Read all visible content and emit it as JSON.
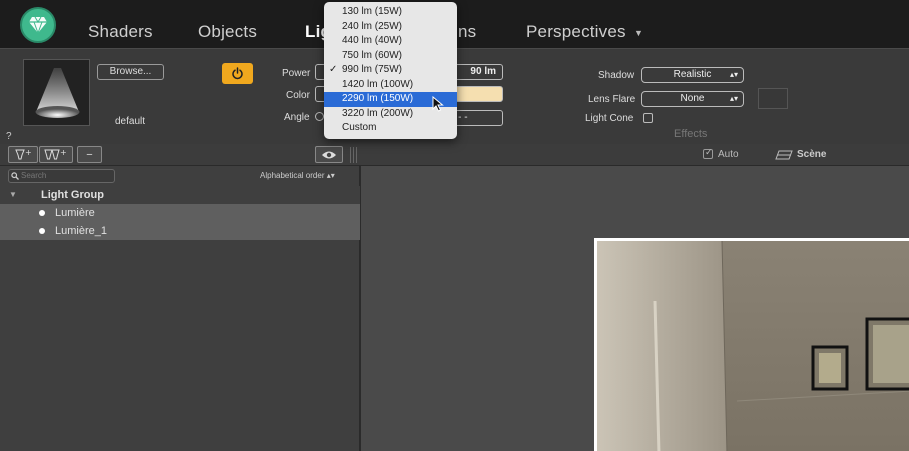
{
  "tabs": [
    {
      "label": "Shaders",
      "active": false
    },
    {
      "label": "Objects",
      "active": false
    },
    {
      "label": "Lig",
      "active": true
    },
    {
      "label": "ns",
      "active": false
    },
    {
      "label": "Perspectives",
      "active": false
    }
  ],
  "colors": {
    "accent_green": "#3fb98d",
    "power_orange": "#f0a81e",
    "selection_blue": "#2a6bd6",
    "light_color_swatch": "#f5dfb0"
  },
  "light": {
    "browse_label": "Browse...",
    "preset_name": "default",
    "help": "?",
    "power_label": "Power",
    "power_value": "90 lm",
    "color_label": "Color",
    "angle_label": "Angle",
    "angle_value": "- - -"
  },
  "effects": {
    "shadow_label": "Shadow",
    "shadow_value": "Realistic",
    "lens_flare_label": "Lens Flare",
    "lens_flare_value": "None",
    "light_cone_label": "Light Cone",
    "section_label": "Effects"
  },
  "toolbar": {
    "minus_label": "−",
    "auto_label": "Auto",
    "scene_label": "Scène"
  },
  "list": {
    "search_placeholder": "Search",
    "sort_label": "Alphabetical order",
    "group_label": "Light Group",
    "items": [
      {
        "label": "Lumière"
      },
      {
        "label": "Lumière_1"
      }
    ]
  },
  "power_menu": {
    "items": [
      {
        "label": "130 lm (15W)",
        "checked": false,
        "selected": false
      },
      {
        "label": "240 lm (25W)",
        "checked": false,
        "selected": false
      },
      {
        "label": "440 lm (40W)",
        "checked": false,
        "selected": false
      },
      {
        "label": "750 lm (60W)",
        "checked": false,
        "selected": false
      },
      {
        "label": "990 lm (75W)",
        "checked": true,
        "selected": false
      },
      {
        "label": "1420 lm (100W)",
        "checked": false,
        "selected": false
      },
      {
        "label": "2290 lm (150W)",
        "checked": false,
        "selected": true
      },
      {
        "label": "3220 lm (200W)",
        "checked": false,
        "selected": false
      },
      {
        "label": "Custom",
        "checked": false,
        "selected": false
      }
    ],
    "check_glyph": "✓"
  }
}
